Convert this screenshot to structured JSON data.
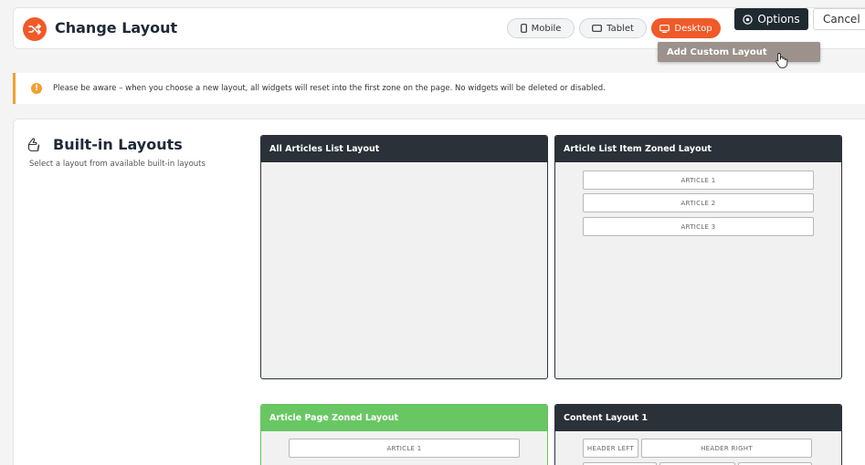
{
  "header": {
    "title": "Change Layout",
    "view_buttons": {
      "mobile": "Mobile",
      "tablet": "Tablet",
      "desktop": "Desktop"
    },
    "options_label": "Options",
    "cancel_label": "Cancel"
  },
  "dropdown": {
    "item": "Add Custom Layout"
  },
  "alert": {
    "message": "Please be aware – when you choose a new layout, all widgets will reset into the first zone on the page. No widgets will be deleted or disabled."
  },
  "builtin": {
    "title": "Built-in Layouts",
    "subtitle": "Select a layout from available built-in layouts",
    "cards": [
      {
        "title": "All Articles List Layout"
      },
      {
        "title": "Article List Item Zoned Layout",
        "slots": [
          "ARTICLE 1",
          "ARTICLE 2",
          "ARTICLE 3"
        ]
      },
      {
        "title": "Article Page Zoned Layout",
        "slots": [
          "ARTICLE 1"
        ]
      },
      {
        "title": "Content Layout 1",
        "slots": [
          "HEADER LEFT",
          "HEADER RIGHT"
        ]
      }
    ]
  },
  "colors": {
    "accent": "#f05a28",
    "dark": "#2b3138",
    "selected": "#68c763",
    "warning": "#f0a030"
  }
}
